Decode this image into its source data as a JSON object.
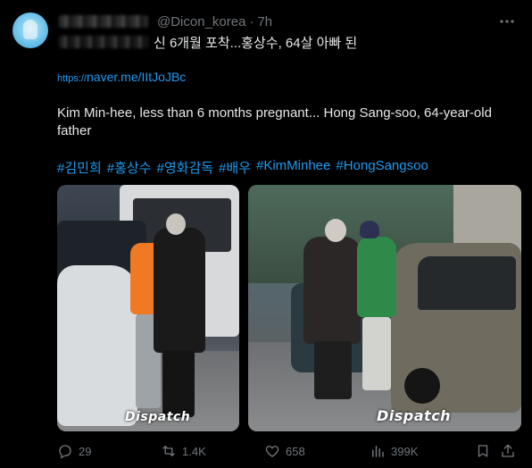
{
  "post": {
    "handle": "@Dicon_korea",
    "separator": "·",
    "time": "7h",
    "korean_title": "신 6개월 포착...홍상수, 64살 아빠 된",
    "link_prefix": "https://",
    "link_main": "naver.me/IItJoJBc",
    "body_text": "Kim Min-hee, less than 6 months pregnant... Hong Sang-soo, 64-year-old father",
    "hashtags": [
      "#김민희",
      "#홍상수",
      "#영화감독",
      "#배우",
      "#KimMinhee",
      "#HongSangsoo"
    ],
    "watermark_left": "Dispatch",
    "watermark_right": "Dispatch"
  },
  "actions": {
    "reply_count": "29",
    "repost_count": "1.4K",
    "like_count": "658",
    "view_count": "399K"
  },
  "icons": {
    "more": "more-dots-icon",
    "reply": "reply-bubble-icon",
    "repost": "repost-arrows-icon",
    "like": "heart-icon",
    "views": "bar-chart-icon",
    "bookmark": "bookmark-icon",
    "share": "share-icon"
  },
  "colors": {
    "background": "#000000",
    "text": "#e7e9ea",
    "muted": "#71767b",
    "link": "#1d9bf0"
  }
}
